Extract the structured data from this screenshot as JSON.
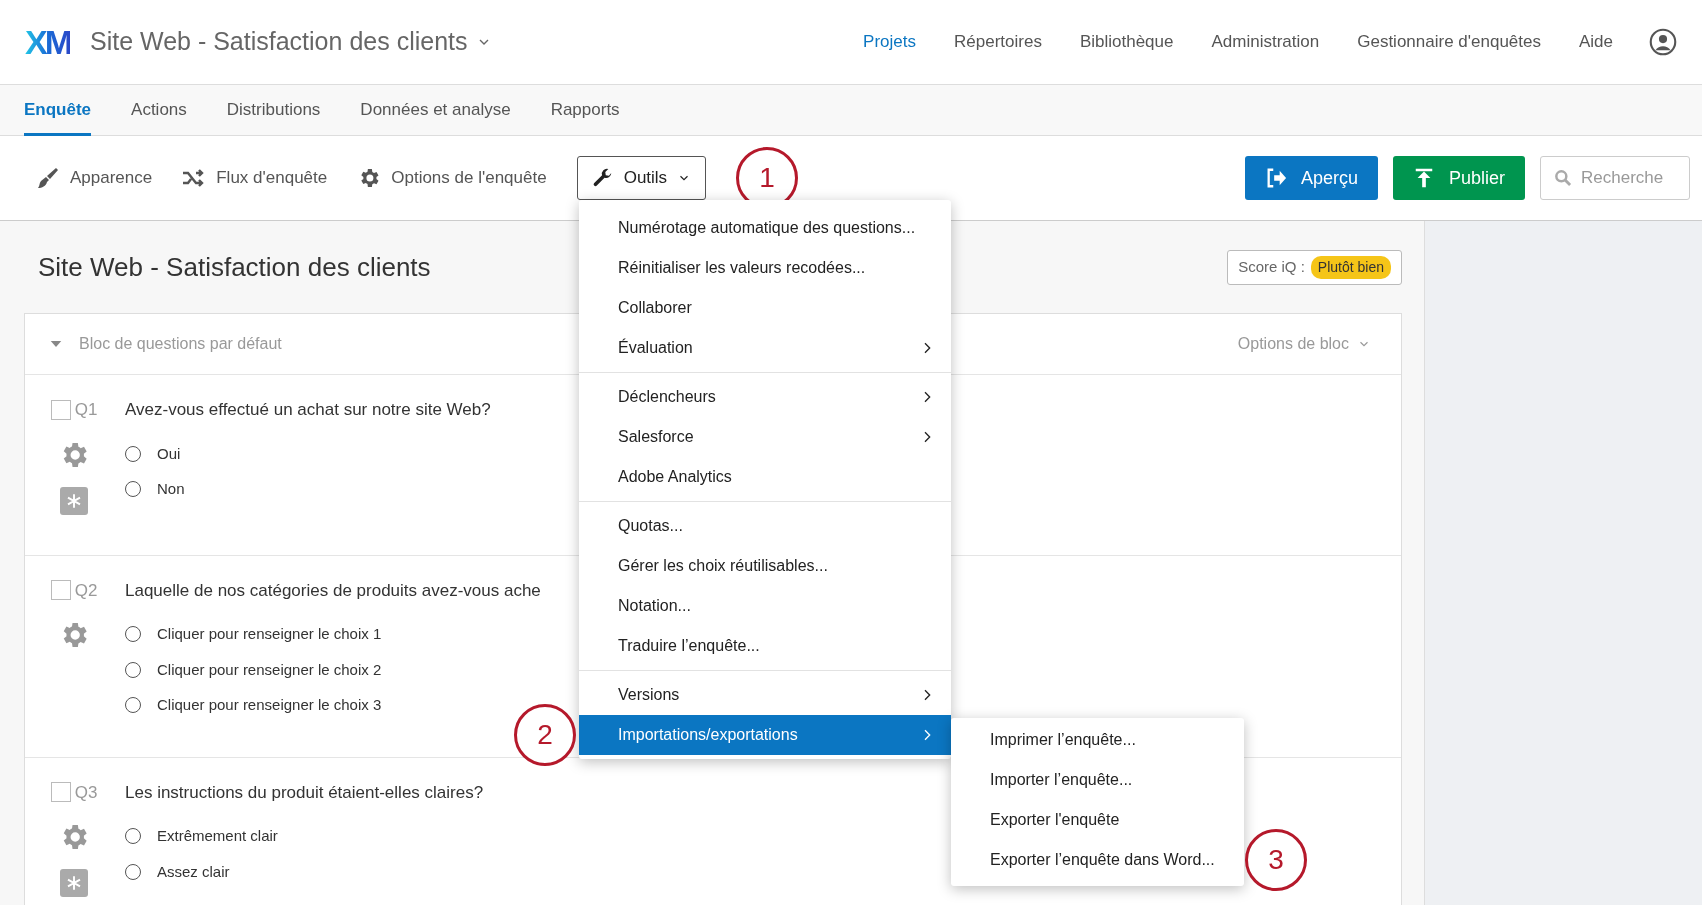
{
  "header": {
    "logo": "XM",
    "project_title": "Site Web - Satisfaction des clients",
    "nav": [
      {
        "label": "Projets",
        "selected": true
      },
      {
        "label": "Répertoires",
        "selected": false
      },
      {
        "label": "Bibliothèque",
        "selected": false
      },
      {
        "label": "Administration",
        "selected": false
      },
      {
        "label": "Gestionnaire d'enquêtes",
        "selected": false
      },
      {
        "label": "Aide",
        "selected": false
      }
    ]
  },
  "tabs": [
    {
      "label": "Enquête",
      "selected": true
    },
    {
      "label": "Actions",
      "selected": false
    },
    {
      "label": "Distributions",
      "selected": false
    },
    {
      "label": "Données et analyse",
      "selected": false
    },
    {
      "label": "Rapports",
      "selected": false
    }
  ],
  "toolbar": {
    "items": [
      {
        "kind": "brush",
        "label": "Apparence"
      },
      {
        "kind": "flow",
        "label": "Flux d'enquête"
      },
      {
        "kind": "gear",
        "label": "Options de l'enquête"
      }
    ],
    "tools_button": {
      "label": "Outils",
      "annotation": "1"
    },
    "preview_button": "Aperçu",
    "publish_button": "Publier",
    "search": {
      "placeholder": "Recherche"
    }
  },
  "survey": {
    "title": "Site Web - Satisfaction des clients",
    "score_label": "Score iQ :",
    "score_value": "Plutôt bien",
    "block": {
      "title": "Bloc de questions par défaut",
      "options": "Options de bloc",
      "questions": [
        {
          "number": "Q1",
          "checked": false,
          "text": "Avez-vous effectué un achat sur notre site Web?",
          "required": true,
          "choices": [
            {
              "label": "Oui",
              "selected": false
            },
            {
              "label": "Non",
              "selected": false
            }
          ]
        },
        {
          "number": "Q2",
          "checked": false,
          "text": "Laquelle de nos catégories de produits avez-vous ache",
          "required": false,
          "choices": [
            {
              "label": "Cliquer pour renseigner le choix 1",
              "selected": false
            },
            {
              "label": "Cliquer pour renseigner le choix 2",
              "selected": false
            },
            {
              "label": "Cliquer pour renseigner le choix 3",
              "selected": false
            }
          ]
        },
        {
          "number": "Q3",
          "checked": false,
          "text": "Les instructions du produit étaient-elles claires?",
          "required": true,
          "choices": [
            {
              "label": "Extrêmement clair",
              "selected": false
            },
            {
              "label": "Assez clair",
              "selected": false
            }
          ]
        }
      ]
    }
  },
  "tools_menu": {
    "groups": [
      [
        {
          "label": "Numérotage automatique des questions...",
          "submenu": false,
          "selected": false
        },
        {
          "label": "Réinitialiser les valeurs recodées...",
          "submenu": false,
          "selected": false
        },
        {
          "label": "Collaborer",
          "submenu": false,
          "selected": false
        },
        {
          "label": "Évaluation",
          "submenu": true,
          "selected": false
        }
      ],
      [
        {
          "label": "Déclencheurs",
          "submenu": true,
          "selected": false
        },
        {
          "label": "Salesforce",
          "submenu": true,
          "selected": false
        },
        {
          "label": "Adobe Analytics",
          "submenu": false,
          "selected": false
        }
      ],
      [
        {
          "label": "Quotas...",
          "submenu": false,
          "selected": false
        },
        {
          "label": "Gérer les choix réutilisables...",
          "submenu": false,
          "selected": false
        },
        {
          "label": "Notation...",
          "submenu": false,
          "selected": false
        },
        {
          "label": "Traduire l’enquête...",
          "submenu": false,
          "selected": false
        }
      ],
      [
        {
          "label": "Versions",
          "submenu": true,
          "selected": false
        },
        {
          "label": "Importations/exportations",
          "submenu": true,
          "selected": true,
          "annotation": "2"
        }
      ]
    ],
    "submenu": [
      {
        "label": "Imprimer l’enquête..."
      },
      {
        "label": "Importer l’enquête..."
      },
      {
        "label": "Exporter l'enquête"
      },
      {
        "label": "Exporter l’enquête dans Word...",
        "annotation": "3"
      }
    ]
  }
}
